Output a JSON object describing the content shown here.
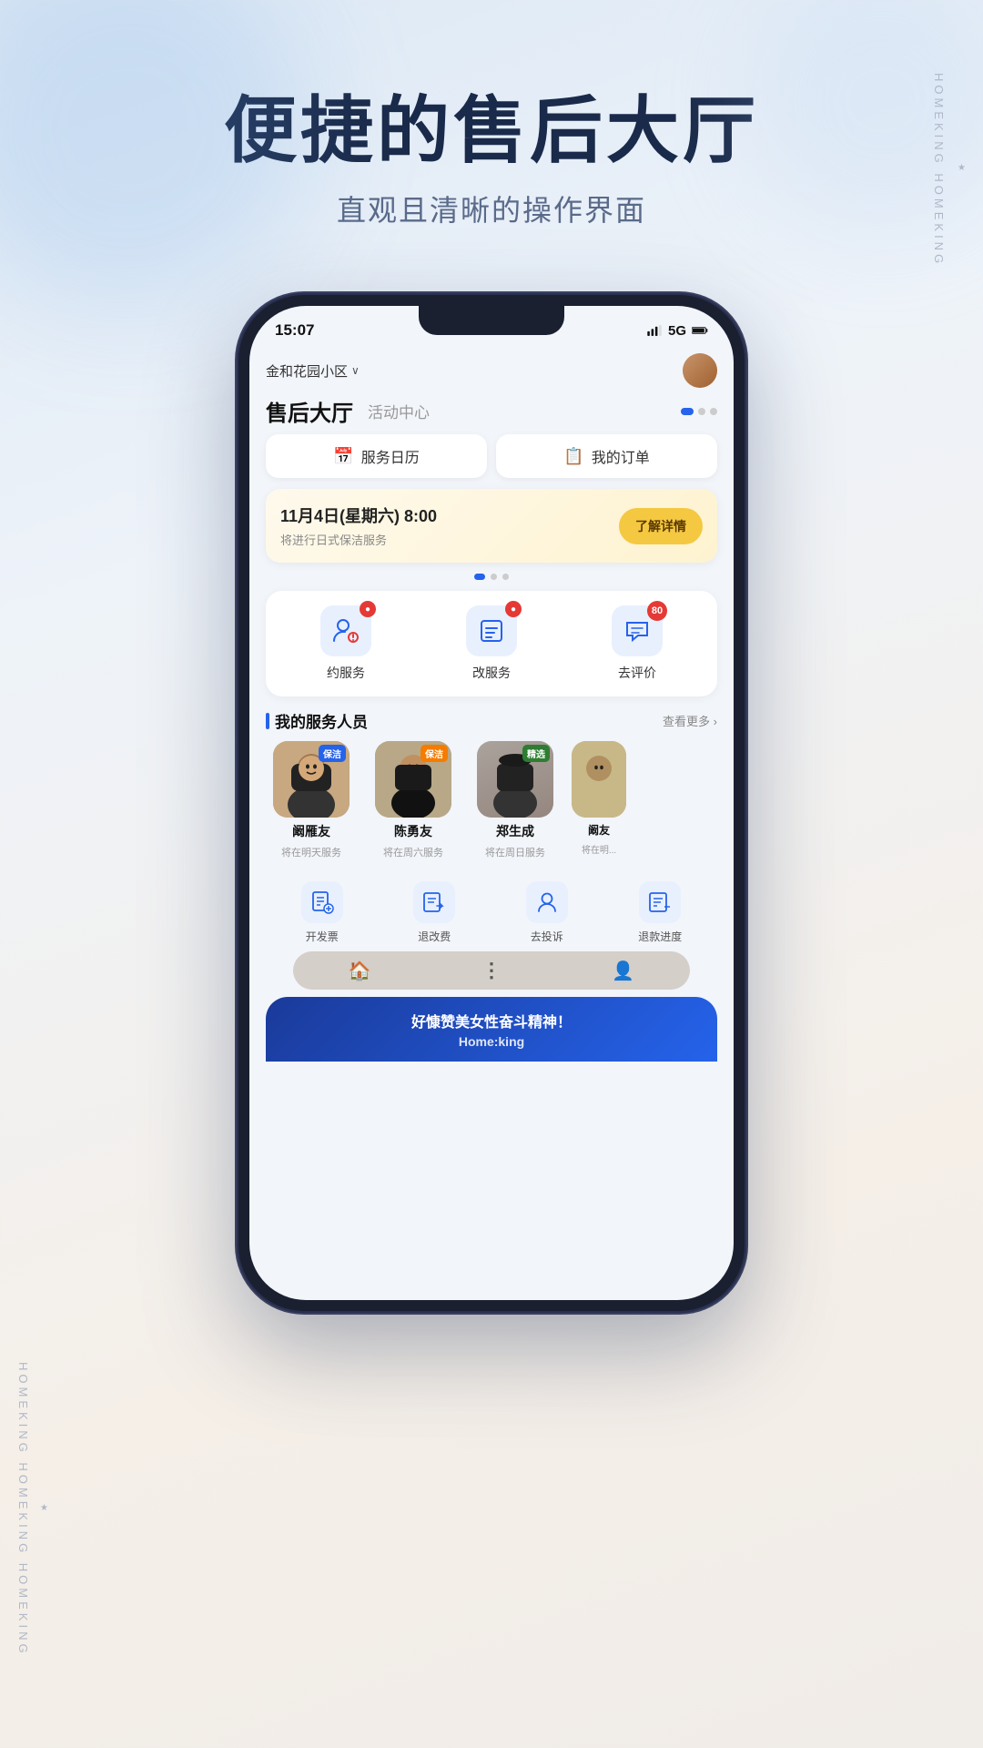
{
  "background": {
    "gradient_start": "#dce8f5",
    "gradient_end": "#f0ece8"
  },
  "side_text": {
    "right": "HOMEKING HOMEKING",
    "left": "HOMEKING HOMEKING HOMEKING"
  },
  "header": {
    "main_title": "便捷的售后大厅",
    "sub_title": "直观且清晰的操作界面"
  },
  "phone": {
    "status_bar": {
      "time": "15:07",
      "signal": "5G"
    },
    "location": {
      "community": "金和花园小区",
      "arrow": "∨"
    },
    "section_title": "售后大厅",
    "section_sub": "活动中心",
    "quick_actions": [
      {
        "icon": "📅",
        "label": "服务日历"
      },
      {
        "icon": "📋",
        "label": "我的订单"
      }
    ],
    "calendar_card": {
      "date": "11月4日(星期六) 8:00",
      "description": "将进行日式保洁服务",
      "button": "了解详情"
    },
    "service_icons": [
      {
        "label": "约服务",
        "badge": "",
        "badge_type": "dot"
      },
      {
        "label": "改服务",
        "badge": "",
        "badge_type": "dot"
      },
      {
        "label": "去评价",
        "badge": "80",
        "badge_type": "number"
      }
    ],
    "staff_section": {
      "title": "我的服务人员",
      "more": "查看更多 ›",
      "staff": [
        {
          "name": "阚雁友",
          "tag": "保洁",
          "tag_color": "blue",
          "schedule": "将在明天服务"
        },
        {
          "name": "陈勇友",
          "tag": "保洁",
          "tag_color": "orange",
          "schedule": "将在周六服务"
        },
        {
          "name": "郑生成",
          "tag": "精选",
          "tag_color": "green",
          "schedule": "将在周日服务"
        },
        {
          "name": "阚友",
          "tag": "",
          "tag_color": "",
          "schedule": "将在明..."
        }
      ]
    },
    "bottom_tools": [
      {
        "label": "开发票"
      },
      {
        "label": "退改费"
      },
      {
        "label": "去投诉"
      },
      {
        "label": "退款进度"
      }
    ],
    "tab_bar": [
      {
        "icon": "🏠",
        "active": true
      },
      {
        "icon": "⋮",
        "active": false
      },
      {
        "icon": "👤",
        "active": false
      }
    ],
    "bottom_banner": {
      "title": "好慷赞美女性奋斗精神！",
      "subtitle": "Home:king"
    }
  }
}
